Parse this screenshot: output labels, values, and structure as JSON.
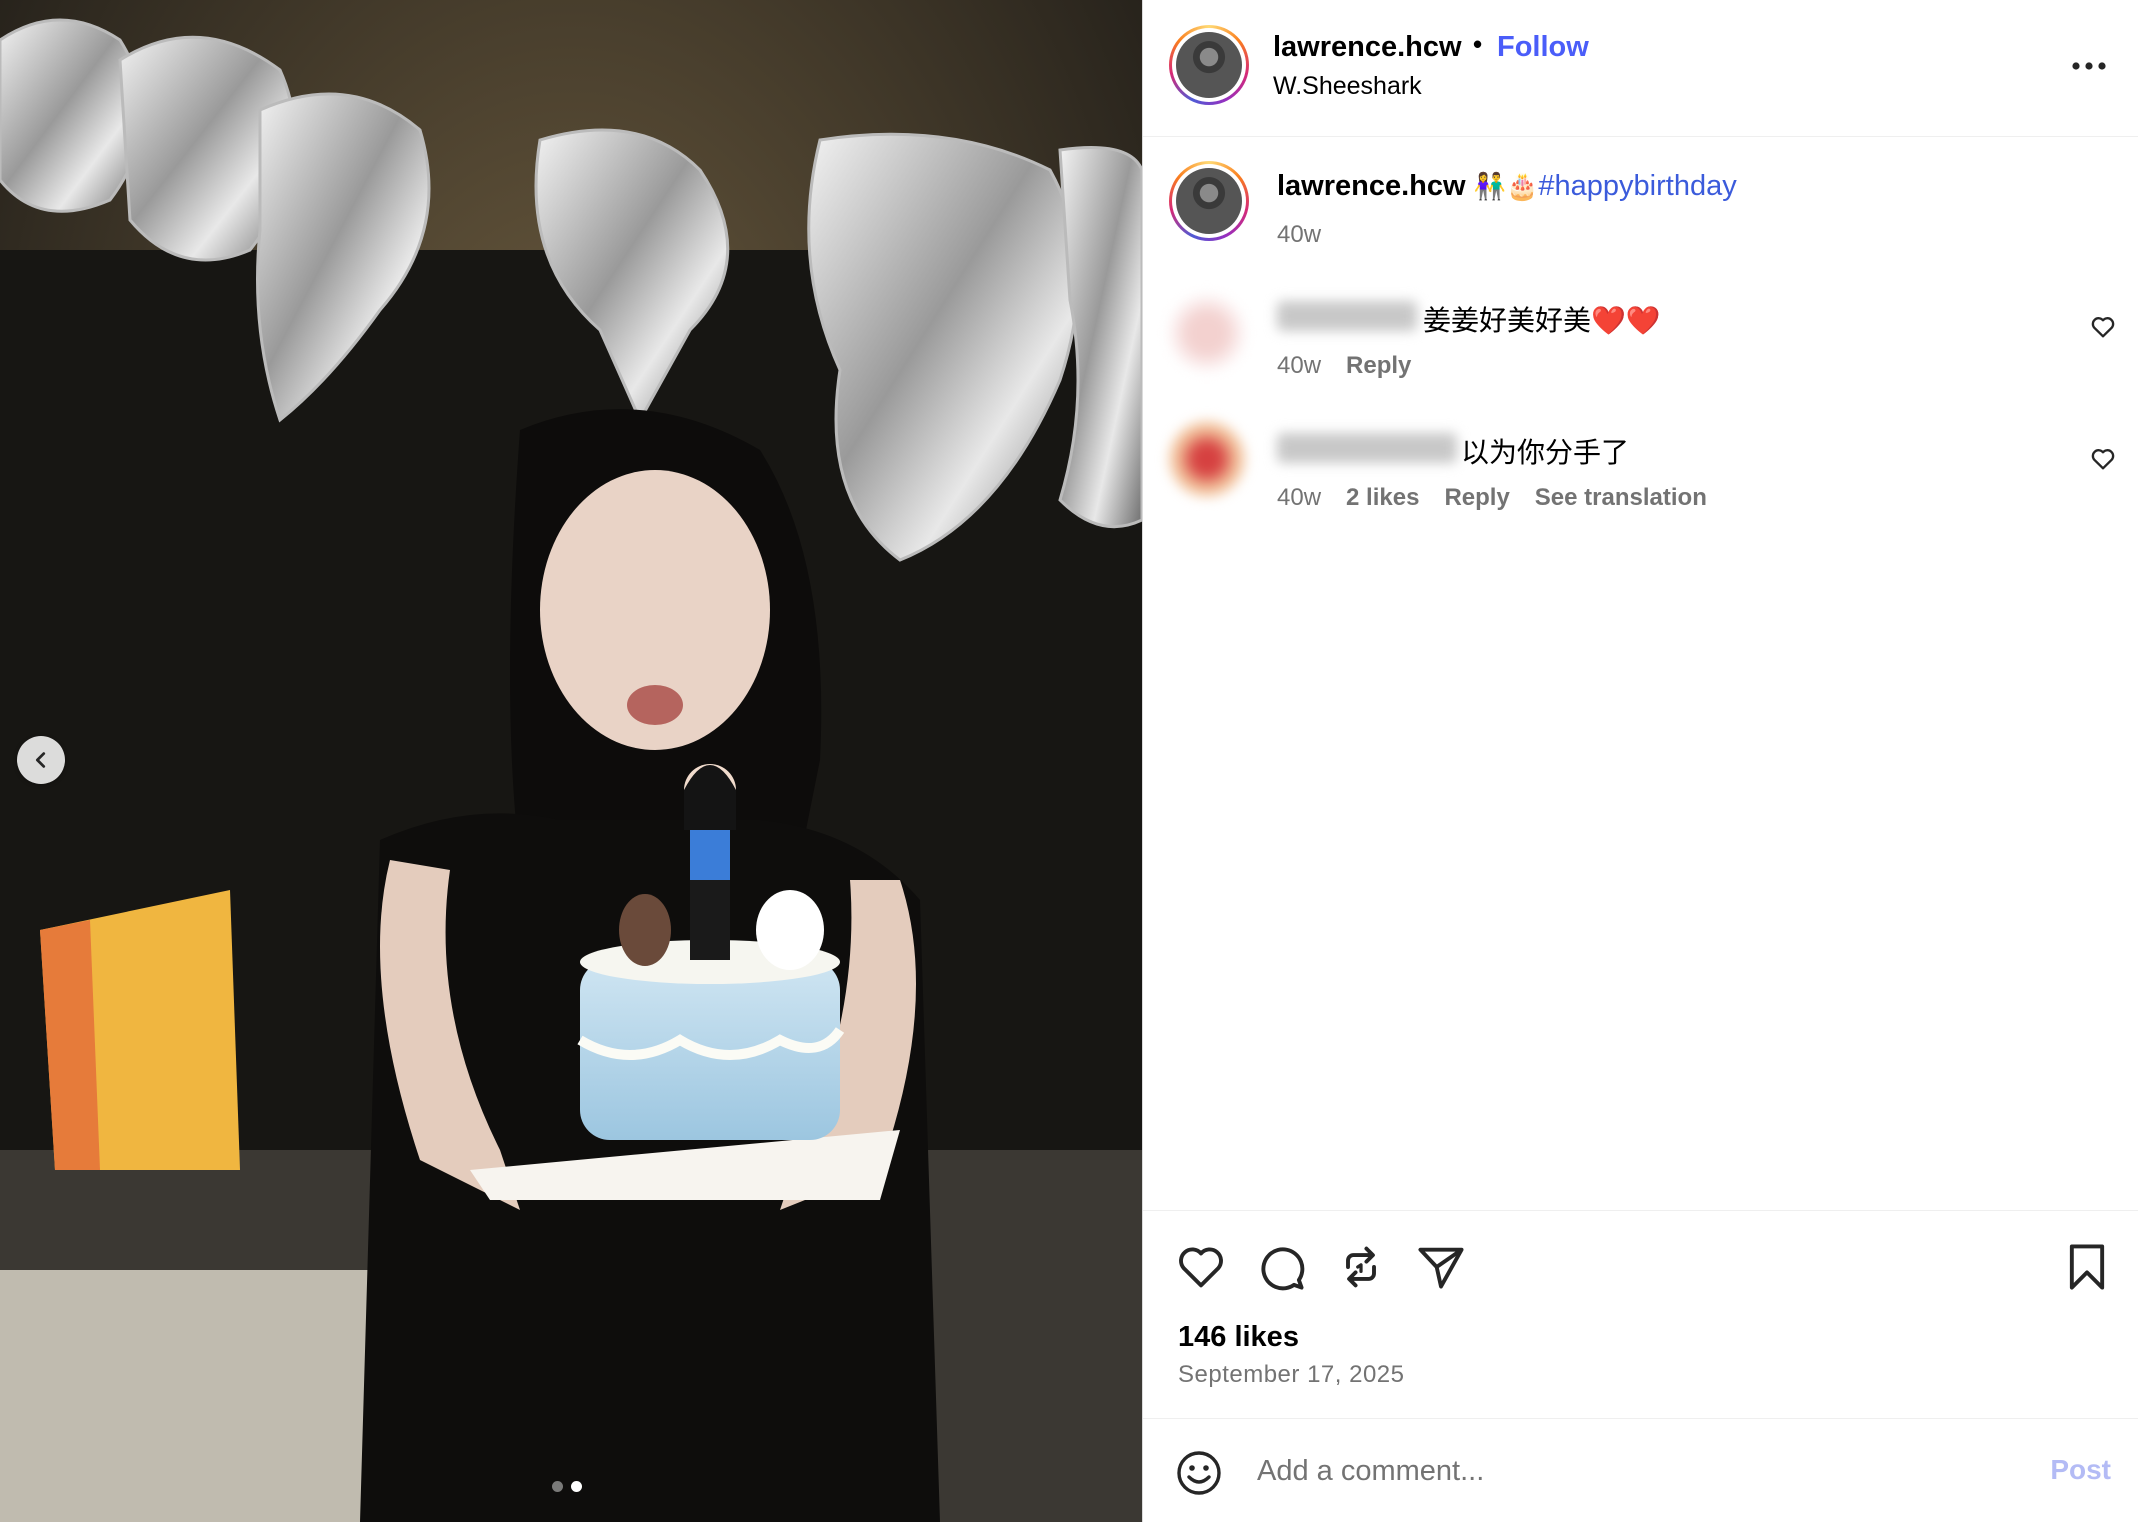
{
  "post": {
    "username": "lawrence.hcw",
    "separator": "•",
    "follow_label": "Follow",
    "location": "W.Sheeshark"
  },
  "caption": {
    "username": "lawrence.hcw",
    "emojis": "👫🎂",
    "hashtag": "#happybirthday",
    "time": "40w"
  },
  "comments": [
    {
      "text": "姜姜好美好美❤️❤️",
      "time": "40w",
      "reply_label": "Reply"
    },
    {
      "text": "以为你分手了",
      "time": "40w",
      "likes": "2 likes",
      "reply_label": "Reply",
      "translate_label": "See translation"
    }
  ],
  "engagement": {
    "likes": "146 likes",
    "date": "September 17, 2025"
  },
  "composer": {
    "placeholder": "Add a comment...",
    "post_label": "Post"
  },
  "carousel": {
    "total_slides": 2,
    "active_slide": 2
  },
  "icons": {
    "more": "more-horizontal-icon",
    "like": "heart-icon",
    "comment": "comment-icon",
    "repost": "repost-icon",
    "share": "send-icon",
    "save": "bookmark-icon",
    "emoji": "smiley-icon",
    "prev": "chevron-left-icon"
  },
  "colors": {
    "link_blue": "#4a5df9",
    "muted_gray": "#737373",
    "post_disabled": "#b3bbf5"
  }
}
